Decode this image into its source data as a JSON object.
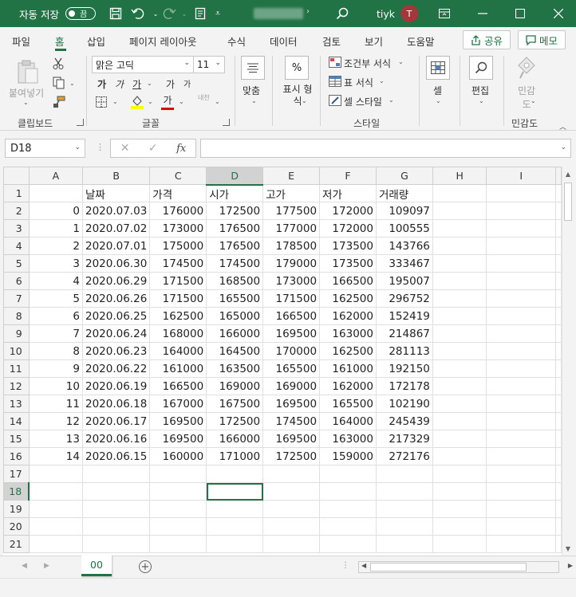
{
  "titlebar": {
    "autosave_label": "자동 저장",
    "autosave_state": "끔",
    "username": "tiyk",
    "avatar_initial": "T",
    "bg_color": "#217346"
  },
  "tabs": {
    "items": [
      "파일",
      "홈",
      "삽입",
      "페이지 레이아웃",
      "수식",
      "데이터",
      "검토",
      "보기",
      "도움말"
    ],
    "active": "홈",
    "share_label": "공유",
    "memo_label": "메모"
  },
  "ribbon": {
    "clipboard": {
      "paste_label": "붙여넣기",
      "group_label": "클립보드"
    },
    "font": {
      "font_name": "맑은 고딕",
      "font_size": "11",
      "group_label": "글꼴",
      "bold": "가",
      "italic": "가",
      "underline": "가",
      "grow": "가",
      "shrink": "가",
      "font_color_glyph": "가",
      "phonetic": "내천"
    },
    "alignment": {
      "label": "맞춤"
    },
    "number": {
      "icon": "%",
      "label": "표시 형식"
    },
    "styles": {
      "conditional": "조건부 서식",
      "table": "표 서식",
      "cell_style": "셀 스타일",
      "group_label": "스타일"
    },
    "cells": {
      "label": "셀"
    },
    "editing": {
      "label": "편집"
    },
    "sensitivity": {
      "label": "민감도",
      "group_label": "민감도"
    }
  },
  "formula_bar": {
    "name_box": "D18",
    "fx": "fx",
    "value": ""
  },
  "grid": {
    "columns": [
      "A",
      "B",
      "C",
      "D",
      "E",
      "F",
      "G",
      "H",
      "I"
    ],
    "selected_column": "D",
    "selected_row": "18",
    "header_row": [
      "",
      "날짜",
      "가격",
      "시가",
      "고가",
      "저가",
      "거래량",
      "",
      ""
    ],
    "rows": [
      [
        "0",
        "2020.07.03",
        "176000",
        "172500",
        "177500",
        "172000",
        "109097"
      ],
      [
        "1",
        "2020.07.02",
        "173000",
        "176500",
        "177000",
        "172000",
        "100555"
      ],
      [
        "2",
        "2020.07.01",
        "175000",
        "176500",
        "178500",
        "173500",
        "143766"
      ],
      [
        "3",
        "2020.06.30",
        "174500",
        "174500",
        "179000",
        "173500",
        "333467"
      ],
      [
        "4",
        "2020.06.29",
        "171500",
        "168500",
        "173000",
        "166500",
        "195007"
      ],
      [
        "5",
        "2020.06.26",
        "171500",
        "165500",
        "171500",
        "162500",
        "296752"
      ],
      [
        "6",
        "2020.06.25",
        "162500",
        "165000",
        "166500",
        "162000",
        "152419"
      ],
      [
        "7",
        "2020.06.24",
        "168000",
        "166000",
        "169500",
        "163000",
        "214867"
      ],
      [
        "8",
        "2020.06.23",
        "164000",
        "164500",
        "170000",
        "162500",
        "281113"
      ],
      [
        "9",
        "2020.06.22",
        "161000",
        "163500",
        "165500",
        "161000",
        "192150"
      ],
      [
        "10",
        "2020.06.19",
        "166500",
        "169000",
        "169000",
        "162000",
        "172178"
      ],
      [
        "11",
        "2020.06.18",
        "167000",
        "167500",
        "169500",
        "165500",
        "102190"
      ],
      [
        "12",
        "2020.06.17",
        "169500",
        "172500",
        "174500",
        "164000",
        "245439"
      ],
      [
        "13",
        "2020.06.16",
        "169500",
        "166000",
        "169500",
        "163000",
        "217329"
      ],
      [
        "14",
        "2020.06.15",
        "160000",
        "171000",
        "172500",
        "159000",
        "272176"
      ]
    ],
    "total_rows": 21
  },
  "sheets": {
    "tabs": [
      "00"
    ],
    "active": "00"
  }
}
